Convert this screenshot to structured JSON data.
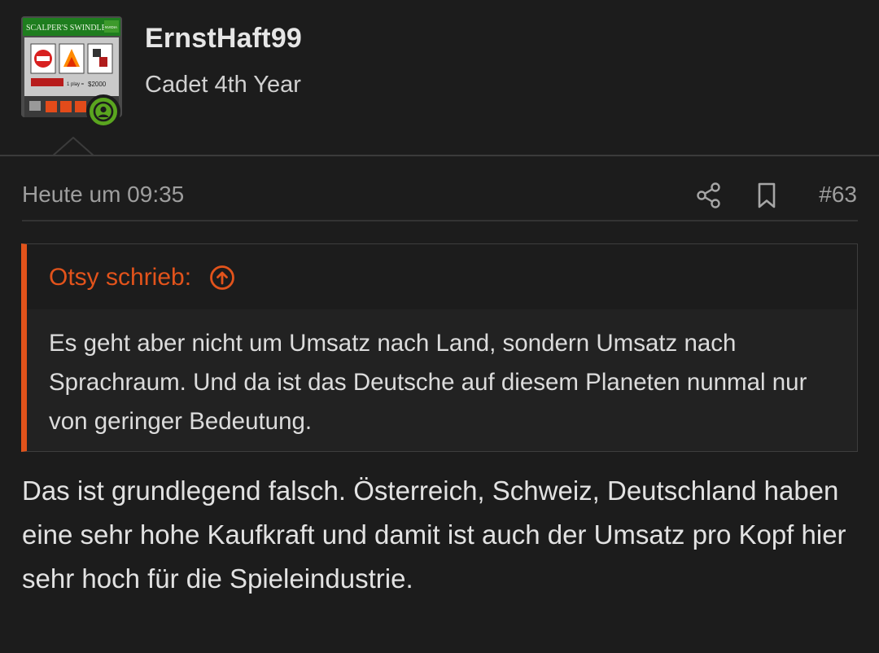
{
  "user": {
    "name": "ErnstHaft99",
    "title": "Cadet 4th Year",
    "avatar": {
      "banner_text": "SCALPER'S SWINDLE",
      "brand_text": "NVIDIA",
      "price_text": "$2000",
      "play_text": "1 play ="
    },
    "online_color": "#5aa51f"
  },
  "post": {
    "time": "Heute um 09:35",
    "number": "#63",
    "quote": {
      "author": "Otsy schrieb:",
      "text": "Es geht aber nicht um Umsatz nach Land, sondern Umsatz nach Sprachraum. Und da ist das Deutsche auf diesem Planeten nunmal nur von geringer Bedeutung."
    },
    "body": "Das ist grundlegend falsch. Österreich, Schweiz, Deutschland haben eine sehr hohe Kaufkraft und damit ist auch der Umsatz pro Kopf hier sehr hoch für die Spieleindustrie."
  },
  "colors": {
    "accent": "#e2531b",
    "background": "#1c1c1c",
    "quote_background": "#222222"
  },
  "icons": {
    "share": "share-icon",
    "bookmark": "bookmark-icon",
    "quote_jump": "arrow-up-circle-icon",
    "online": "user-icon"
  }
}
